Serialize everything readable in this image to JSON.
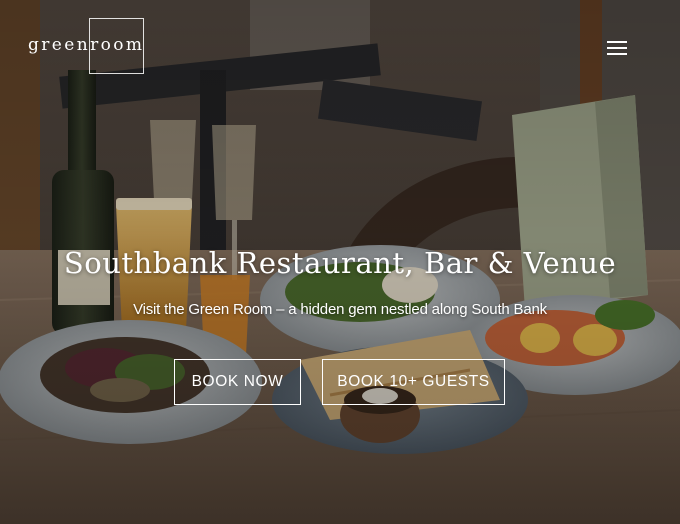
{
  "brand": {
    "logo_text": "greenroom"
  },
  "header": {
    "menu_icon": "hamburger-menu-icon"
  },
  "hero": {
    "title": "Southbank Restaurant, Bar & Venue",
    "subtitle": "Visit the Green Room – a hidden gem nestled along South Bank",
    "buttons": {
      "book_now": "BOOK NOW",
      "book_group": "BOOK 10+ GUESTS"
    }
  },
  "colors": {
    "text": "#ffffff",
    "button_border": "#ffffff"
  }
}
